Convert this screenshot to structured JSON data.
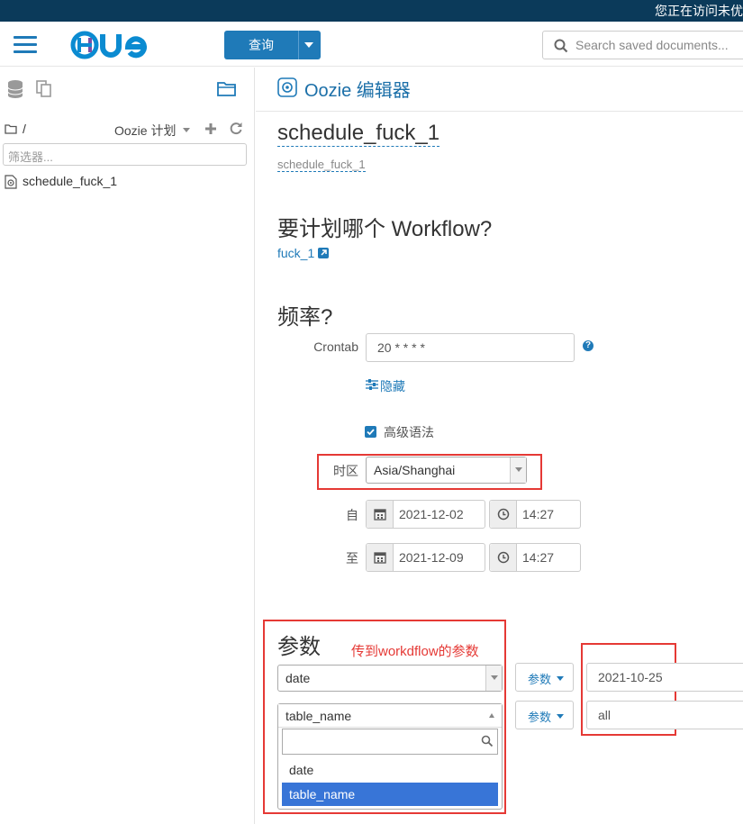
{
  "banner": {
    "text": "您正在访问未优"
  },
  "header": {
    "logo_text": "HUE",
    "query_label": "查询",
    "search_placeholder": "Search saved documents..."
  },
  "sidebar": {
    "path": "/",
    "section_label": "Oozie 计划",
    "filter_placeholder": "筛选器...",
    "items": [
      {
        "label": "schedule_fuck_1"
      }
    ]
  },
  "editor": {
    "title": "Oozie 编辑器",
    "name": "schedule_fuck_1",
    "description": "schedule_fuck_1",
    "workflow_heading": "要计划哪个 Workflow?",
    "workflow_link": "fuck_1",
    "frequency_heading": "频率?",
    "crontab_label": "Crontab",
    "crontab_value": "20 * * * *",
    "hide_link": "隐藏",
    "advanced_syntax_label": "高级语法",
    "advanced_syntax_checked": true,
    "timezone_label": "时区",
    "timezone_value": "Asia/Shanghai",
    "from_label": "自",
    "from_date": "2021-12-02",
    "from_time": "14:27",
    "to_label": "至",
    "to_date": "2021-12-09",
    "to_time": "14:27",
    "params_heading": "参数",
    "params_annotation": "传到workdflow的参数",
    "params": [
      {
        "name": "date",
        "button": "参数",
        "value": "2021-10-25"
      },
      {
        "name": "table_name",
        "button": "参数",
        "value": "all"
      }
    ],
    "dropdown_options": [
      "date",
      "table_name"
    ],
    "dropdown_selected": "table_name"
  },
  "colors": {
    "accent": "#1f7ab8",
    "banner": "#0b3a5a",
    "highlight": "#e53935",
    "selected_option": "#3875d7"
  }
}
